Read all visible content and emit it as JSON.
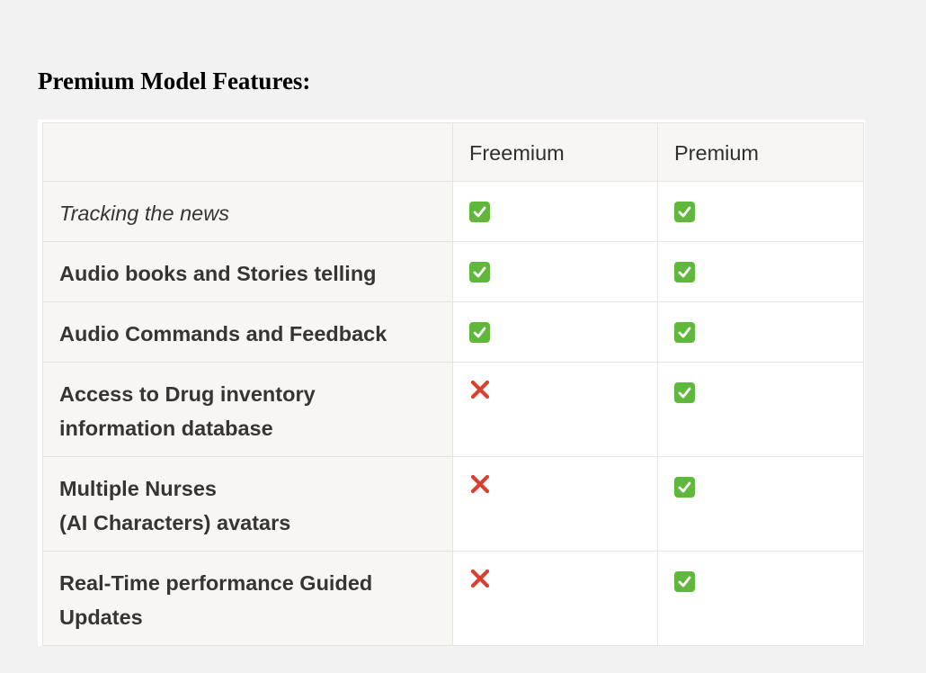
{
  "heading": "Premium Model Features:",
  "table": {
    "headers": [
      "",
      "Freemium",
      "Premium"
    ],
    "rows": [
      {
        "feature": "Tracking the news",
        "freemium": "check",
        "premium": "check"
      },
      {
        "feature": "Audio books and Stories telling",
        "freemium": "check",
        "premium": "check"
      },
      {
        "feature": "Audio Commands and Feedback",
        "freemium": "check",
        "premium": "check"
      },
      {
        "feature": "Access to Drug inventory\ninformation database",
        "freemium": "cross",
        "premium": "check"
      },
      {
        "feature": "Multiple Nurses\n(AI Characters) avatars",
        "freemium": "cross",
        "premium": "check"
      },
      {
        "feature": "Real-Time performance Guided\nUpdates",
        "freemium": "cross",
        "premium": "check"
      }
    ]
  },
  "colors": {
    "check": "#5fb83c",
    "cross": "#d9402f"
  }
}
